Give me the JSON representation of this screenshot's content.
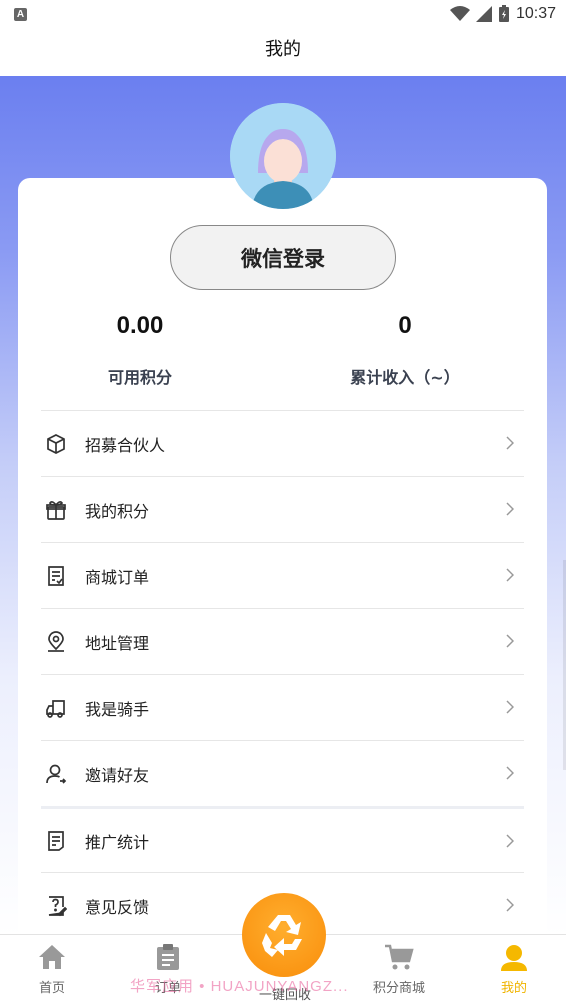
{
  "status_bar": {
    "time": "10:37",
    "app_badge": "A"
  },
  "nav": {
    "title": "我的"
  },
  "profile": {
    "login_label": "微信登录"
  },
  "stats": [
    {
      "value": "0.00",
      "label": "可用积分"
    },
    {
      "value": "0",
      "label": "累计收入（~）"
    }
  ],
  "menu": [
    {
      "label": "招募合伙人",
      "icon": "box-icon"
    },
    {
      "label": "我的积分",
      "icon": "gift-icon"
    },
    {
      "label": "商城订单",
      "icon": "order-list-icon"
    },
    {
      "label": "地址管理",
      "icon": "location-pin-icon"
    },
    {
      "label": "我是骑手",
      "icon": "delivery-truck-icon"
    },
    {
      "label": "邀请好友",
      "icon": "invite-user-icon"
    },
    {
      "label": "推广统计",
      "icon": "stats-document-icon"
    },
    {
      "label": "意见反馈",
      "icon": "feedback-icon"
    }
  ],
  "tabbar": {
    "tabs": [
      {
        "label": "首页",
        "icon": "home-icon"
      },
      {
        "label": "订单",
        "icon": "clipboard-icon"
      },
      {
        "label": "积分商城",
        "icon": "cart-icon"
      },
      {
        "label": "我的",
        "icon": "user-icon",
        "active": true
      }
    ],
    "center": {
      "label": "一键回收",
      "icon": "recycle-icon"
    }
  },
  "watermark": "华军应用 • HUAJUNYANGZ...",
  "colors": {
    "accent": "#f0b400",
    "recycle": "#f98d0a",
    "gradient_top": "#6b7ff0"
  }
}
